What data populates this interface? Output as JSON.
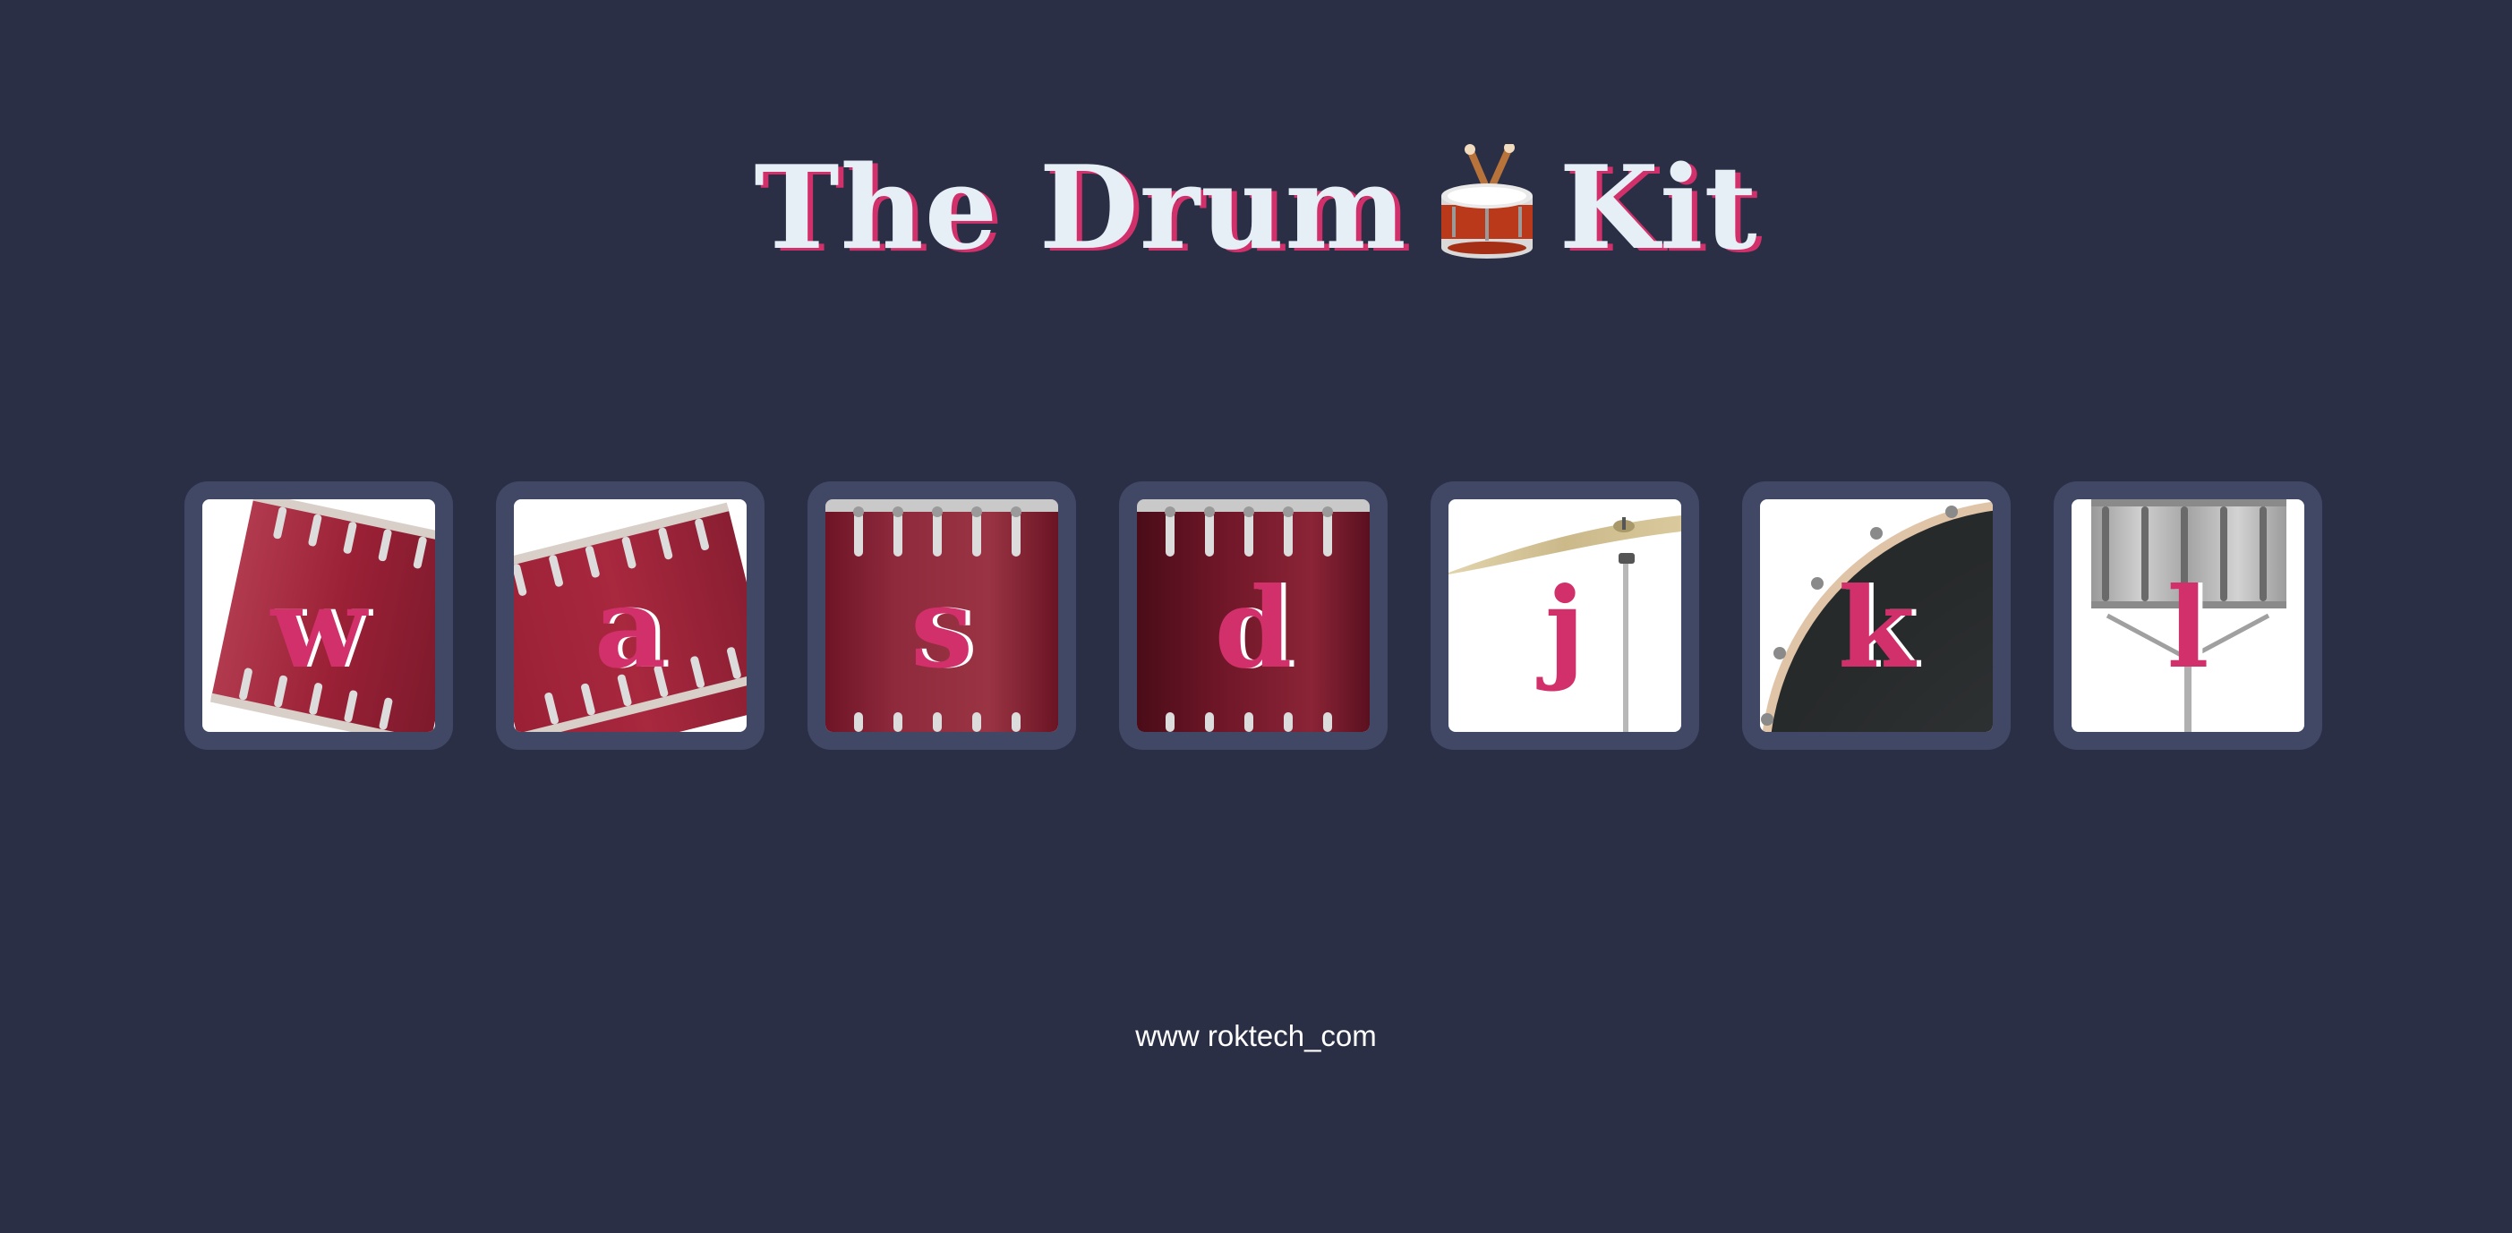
{
  "page": {
    "title_left": "The Drum",
    "title_right": "Kit",
    "title_icon": "drum-emoji",
    "footer": "www roktech_com"
  },
  "drums": [
    {
      "key": "w",
      "instrument_icon": "tom-drum-icon"
    },
    {
      "key": "a",
      "instrument_icon": "tom-drum-icon"
    },
    {
      "key": "s",
      "instrument_icon": "floor-tom-icon"
    },
    {
      "key": "d",
      "instrument_icon": "floor-tom-icon"
    },
    {
      "key": "j",
      "instrument_icon": "crash-cymbal-icon"
    },
    {
      "key": "k",
      "instrument_icon": "kick-drum-icon"
    },
    {
      "key": "l",
      "instrument_icon": "snare-drum-icon"
    }
  ],
  "colors": {
    "background": "#2a2f45",
    "button_frame": "#404866",
    "accent": "#d1306b",
    "title_text": "#e6eef6",
    "drum_red": "#8a1f34",
    "kick_black": "#2e3132",
    "snare_silver": "#b8b8b8"
  }
}
